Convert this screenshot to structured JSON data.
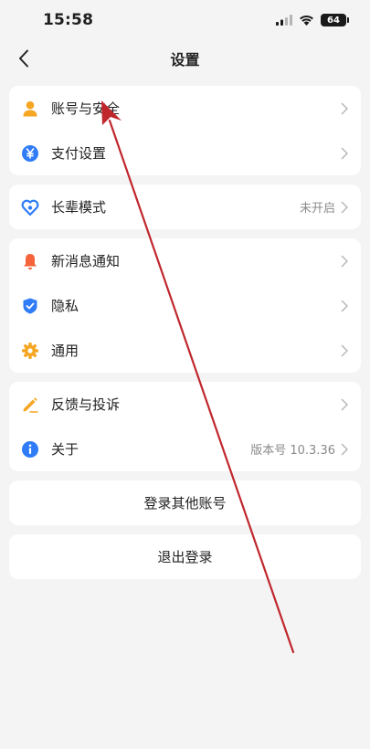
{
  "status_bar": {
    "time": "15:58",
    "battery": "64"
  },
  "header": {
    "title": "设置"
  },
  "groups": [
    {
      "items": [
        {
          "label": "账号与安全",
          "value": "",
          "icon": "person-icon",
          "color": "#f5a623"
        },
        {
          "label": "支付设置",
          "value": "",
          "icon": "yen-icon",
          "color": "#2f7cf6"
        }
      ]
    },
    {
      "items": [
        {
          "label": "长辈模式",
          "value": "未开启",
          "icon": "heart-icon",
          "color": "#2f7cf6"
        }
      ]
    },
    {
      "items": [
        {
          "label": "新消息通知",
          "value": "",
          "icon": "bell-icon",
          "color": "#f4633a"
        },
        {
          "label": "隐私",
          "value": "",
          "icon": "shield-icon",
          "color": "#2f7cf6"
        },
        {
          "label": "通用",
          "value": "",
          "icon": "gear-icon",
          "color": "#f5a623"
        }
      ]
    },
    {
      "items": [
        {
          "label": "反馈与投诉",
          "value": "",
          "icon": "pen-icon",
          "color": "#f5a623"
        },
        {
          "label": "关于",
          "value": "版本号 10.3.36",
          "icon": "info-icon",
          "color": "#2f7cf6"
        }
      ]
    }
  ],
  "actions": {
    "switch_account": "登录其他账号",
    "logout": "退出登录"
  },
  "colors": {
    "annotation_arrow": "#c0272d",
    "background": "#f4f4f5"
  }
}
